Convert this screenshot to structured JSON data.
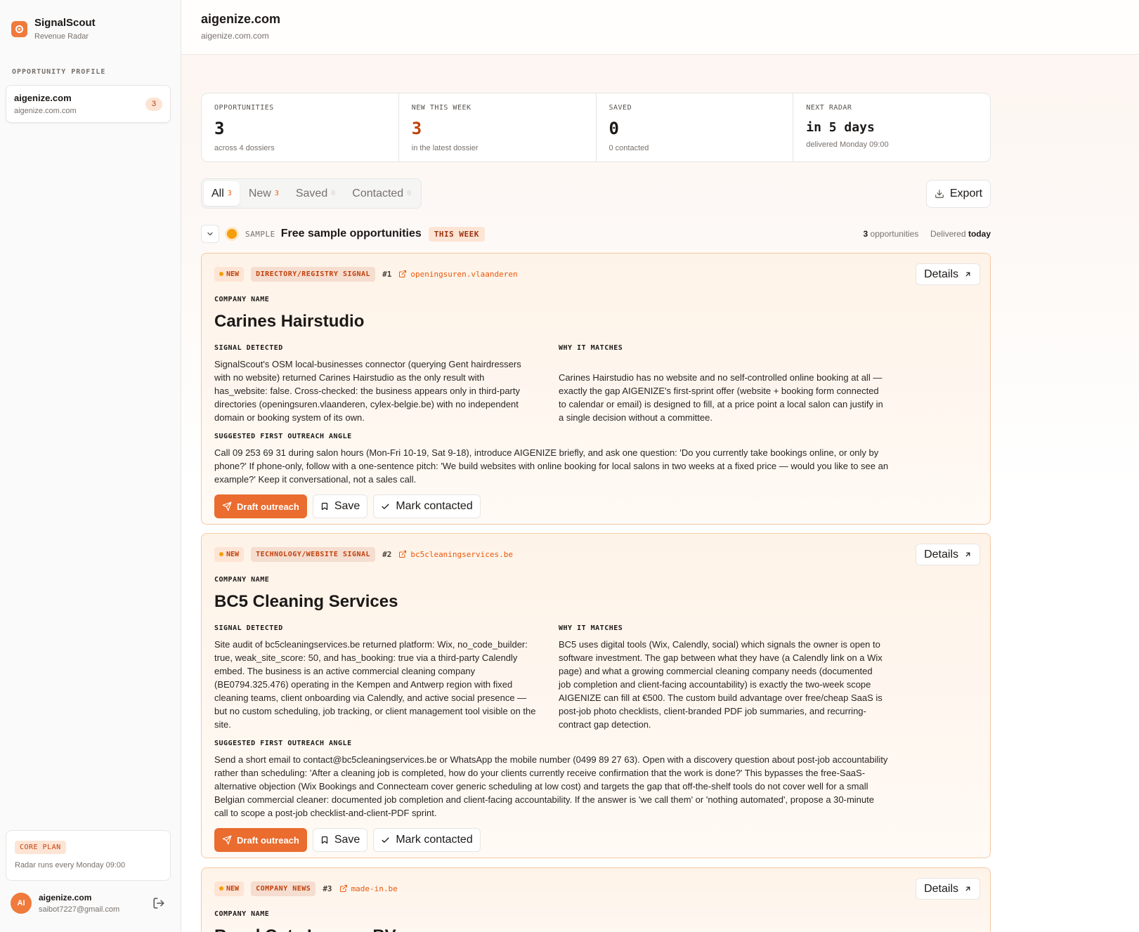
{
  "brand": {
    "name": "SignalScout",
    "subtitle": "Revenue Radar"
  },
  "sidebar": {
    "section_label": "OPPORTUNITY PROFILE",
    "profile": {
      "title": "aigenize.com",
      "subtitle": "aigenize.com.com",
      "count": "3"
    },
    "plan": {
      "badge": "CORE PLAN",
      "text": "Radar runs every Monday 09:00"
    },
    "user": {
      "initials": "AI",
      "name": "aigenize.com",
      "email": "saibot7227@gmail.com"
    }
  },
  "header": {
    "title": "aigenize.com",
    "subtitle": "aigenize.com.com"
  },
  "stats": [
    {
      "label": "OPPORTUNITIES",
      "value": "3",
      "sub": "across 4 dossiers"
    },
    {
      "label": "NEW THIS WEEK",
      "value": "3",
      "sub": "in the latest dossier"
    },
    {
      "label": "SAVED",
      "value": "0",
      "sub": "0 contacted"
    },
    {
      "label": "NEXT RADAR",
      "value": "in 5 days",
      "sub": "delivered Monday 09:00"
    }
  ],
  "filters": [
    {
      "label": "All",
      "count": "3"
    },
    {
      "label": "New",
      "count": "3"
    },
    {
      "label": "Saved",
      "count": "0"
    },
    {
      "label": "Contacted",
      "count": "0"
    }
  ],
  "export_label": "Export",
  "dossier": {
    "tag": "SAMPLE",
    "title": "Free sample opportunities",
    "badge": "THIS WEEK",
    "count": "3",
    "count_suffix": "opportunities",
    "delivered_prefix": "Delivered",
    "delivered_value": "today"
  },
  "labels": {
    "company_name": "COMPANY NAME",
    "signal_detected": "SIGNAL DETECTED",
    "why_it_matches": "WHY IT MATCHES",
    "outreach_angle": "SUGGESTED FIRST OUTREACH ANGLE",
    "new_badge": "NEW",
    "details": "Details",
    "draft_outreach": "Draft outreach",
    "save": "Save",
    "mark_contacted": "Mark contacted"
  },
  "opportunities": [
    {
      "rank": "#1",
      "signal_type": "DIRECTORY/REGISTRY SIGNAL",
      "source": "openingsuren.vlaanderen",
      "company": "Carines Hairstudio",
      "signal": "SignalScout's OSM local-businesses connector (querying Gent hairdressers with no website) returned Carines Hairstudio as the only result with has_website: false. Cross-checked: the business appears only in third-party directories (openingsuren.vlaanderen, cylex-belgie.be) with no independent domain or booking system of its own.",
      "why": "Carines Hairstudio has no website and no self-controlled online booking at all — exactly the gap AIGENIZE's first-sprint offer (website + booking form connected to calendar or email) is designed to fill, at a price point a local salon can justify in a single decision without a committee.",
      "outreach": "Call 09 253 69 31 during salon hours (Mon-Fri 10-19, Sat 9-18), introduce AIGENIZE briefly, and ask one question: 'Do you currently take bookings online, or only by phone?' If phone-only, follow with a one-sentence pitch: 'We build websites with online booking for local salons in two weeks at a fixed price — would you like to see an example?' Keep it conversational, not a sales call."
    },
    {
      "rank": "#2",
      "signal_type": "TECHNOLOGY/WEBSITE SIGNAL",
      "source": "bc5cleaningservices.be",
      "company": "BC5 Cleaning Services",
      "signal": "Site audit of bc5cleaningservices.be returned platform: Wix, no_code_builder: true, weak_site_score: 50, and has_booking: true via a third-party Calendly embed. The business is an active commercial cleaning company (BE0794.325.476) operating in the Kempen and Antwerp region with fixed cleaning teams, client onboarding via Calendly, and active social presence — but no custom scheduling, job tracking, or client management tool visible on the site.",
      "why": "BC5 uses digital tools (Wix, Calendly, social) which signals the owner is open to software investment. The gap between what they have (a Calendly link on a Wix page) and what a growing commercial cleaning company needs (documented job completion and client-facing accountability) is exactly the two-week scope AIGENIZE can fill at €500. The custom build advantage over free/cheap SaaS is post-job photo checklists, client-branded PDF job summaries, and recurring-contract gap detection.",
      "outreach": "Send a short email to contact@bc5cleaningservices.be or WhatsApp the mobile number (0499 89 27 63). Open with a discovery question about post-job accountability rather than scheduling: 'After a cleaning job is completed, how do your clients currently receive confirmation that the work is done?' This bypasses the free-SaaS-alternative objection (Wix Bookings and Connecteam cover generic scheduling at low cost) and targets the gap that off-the-shelf tools do not cover well for a small Belgian commercial cleaner: documented job completion and client-facing accountability. If the answer is 'we call them' or 'nothing automated', propose a 30-minute call to scope a post-job checklist-and-client-PDF sprint."
    },
    {
      "rank": "#3",
      "signal_type": "COMPANY NEWS",
      "source": "made-in.be",
      "company": "Royal Cuts Lounge BV"
    }
  ],
  "colors": {
    "accent": "#ea6c2e",
    "accent_text": "#c2410c",
    "card_border": "#f5c9a3"
  }
}
